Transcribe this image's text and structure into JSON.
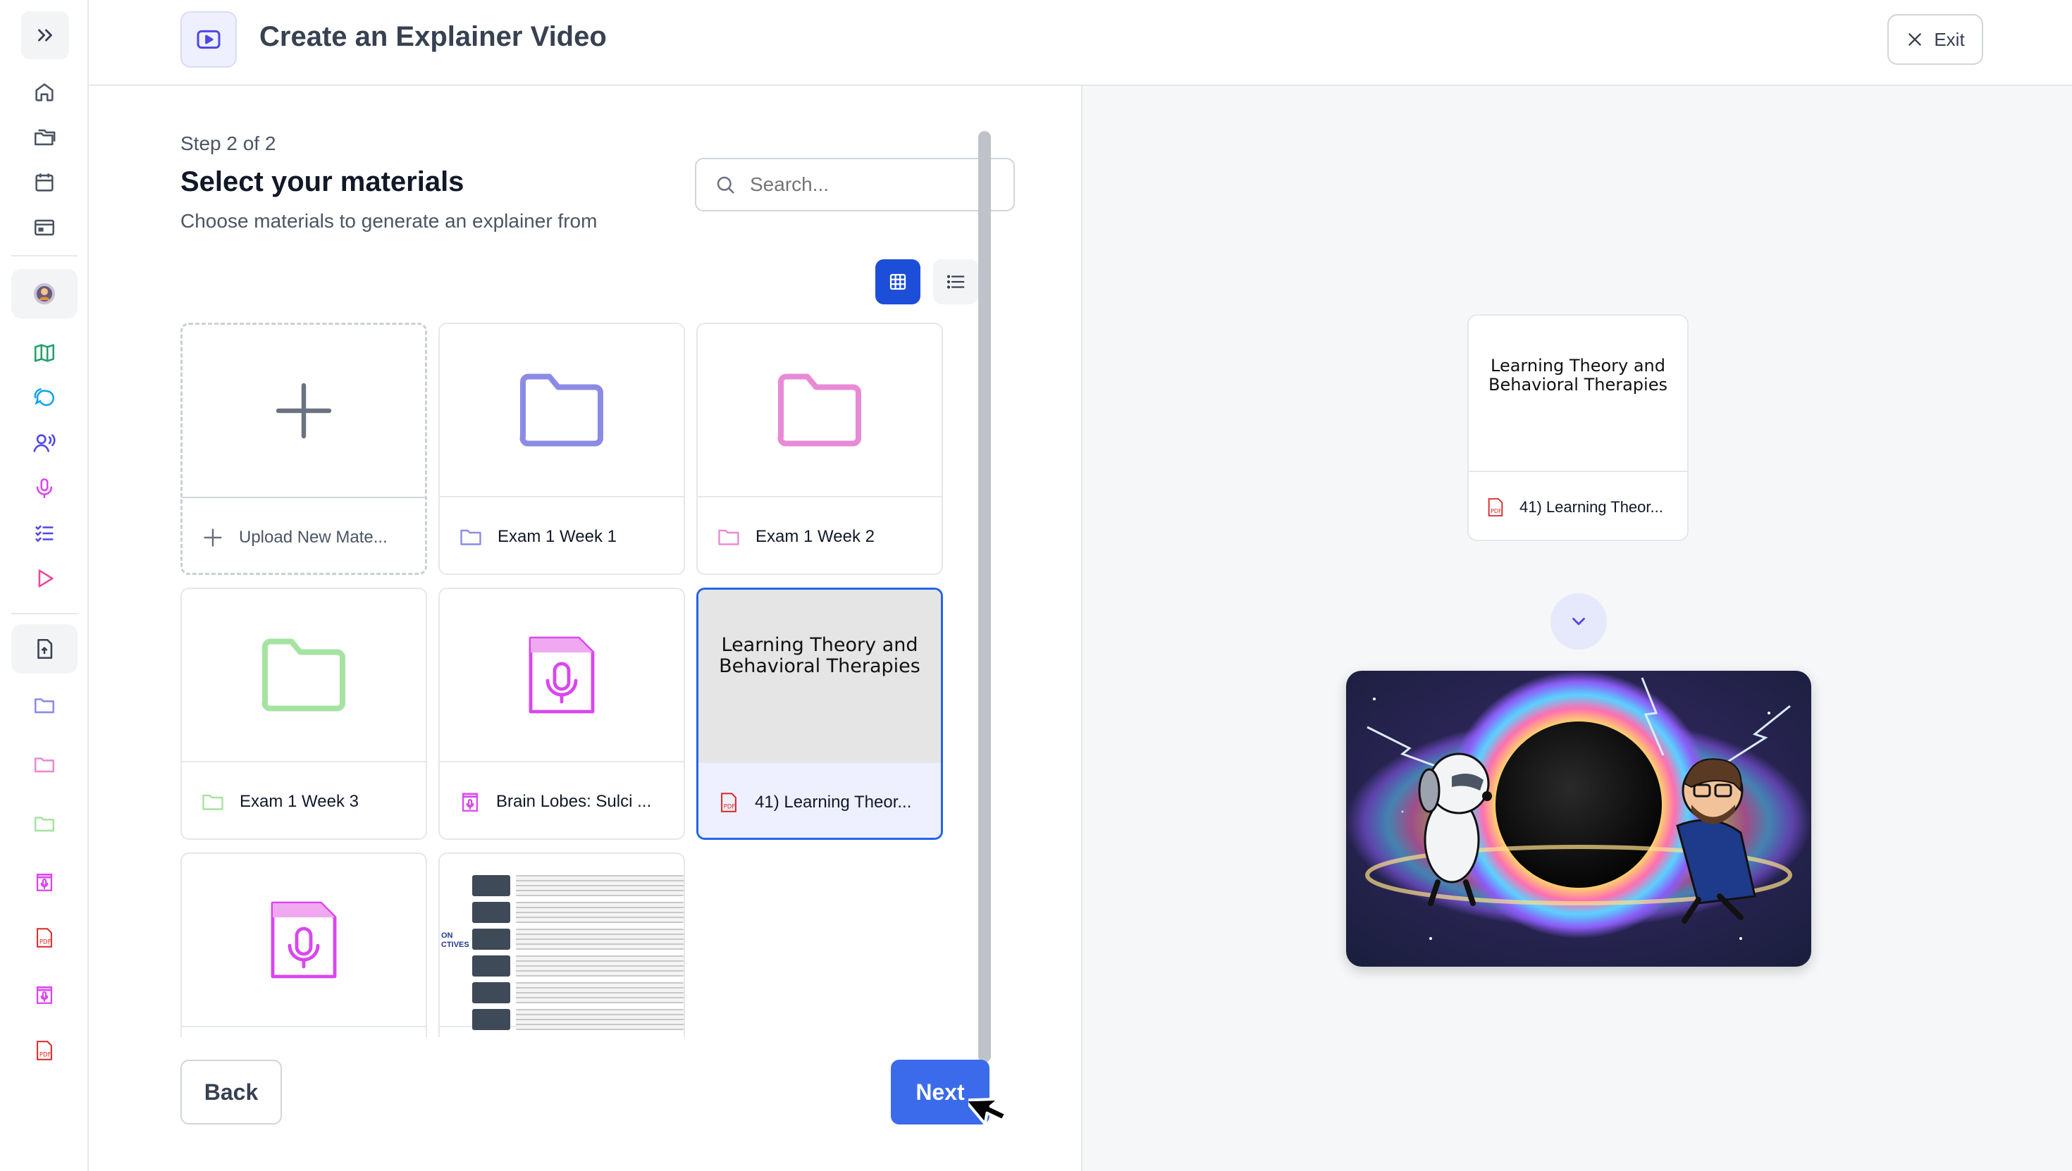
{
  "header": {
    "title": "Create an Explainer Video",
    "exit_label": "Exit"
  },
  "sidebar": {
    "icons": [
      "chevrons-right-icon",
      "home-icon",
      "folders-icon",
      "calendar-icon",
      "browser-icon",
      "avatar",
      "map-icon",
      "chat-icon",
      "voice-icon",
      "mic-icon",
      "checklist-icon",
      "play-icon",
      "upload-file-icon",
      "folder-icon",
      "folder-icon",
      "folder-icon",
      "audio-file-icon",
      "pdf-icon",
      "audio-file-icon",
      "pdf-icon"
    ],
    "pdf_label": "PDF"
  },
  "wizard": {
    "step": "Step 2 of 2",
    "title": "Select your materials",
    "subtitle": "Choose materials to generate an explainer from",
    "search_placeholder": "Search...",
    "back_label": "Back",
    "next_label": "Next"
  },
  "materials": [
    {
      "label": "Upload New Mate...",
      "type": "upload"
    },
    {
      "label": "Exam 1 Week 1",
      "type": "folder",
      "color": "#8b8be6"
    },
    {
      "label": "Exam 1 Week 2",
      "type": "folder",
      "color": "#e88ad6"
    },
    {
      "label": "Exam 1 Week 3",
      "type": "folder",
      "color": "#a6e3a1"
    },
    {
      "label": "Brain Lobes: Sulci ...",
      "type": "audio",
      "color": "#d946ef"
    },
    {
      "label": "41) Learning Theor...",
      "type": "pdf",
      "selected": true,
      "doc_title": "Learning Theory and Behavioral Therapies"
    },
    {
      "label": "",
      "type": "audio",
      "color": "#d946ef"
    },
    {
      "label": "",
      "type": "slides",
      "side_text": "ON\nCTIVES"
    }
  ],
  "preview": {
    "doc_title": "Learning Theory and Behavioral Therapies",
    "file_label": "41) Learning Theor...",
    "pdf_label": "PDF"
  },
  "colors": {
    "primary": "#3b6bea",
    "selected_border": "#2563eb",
    "accent_bg": "#eef0ff"
  }
}
